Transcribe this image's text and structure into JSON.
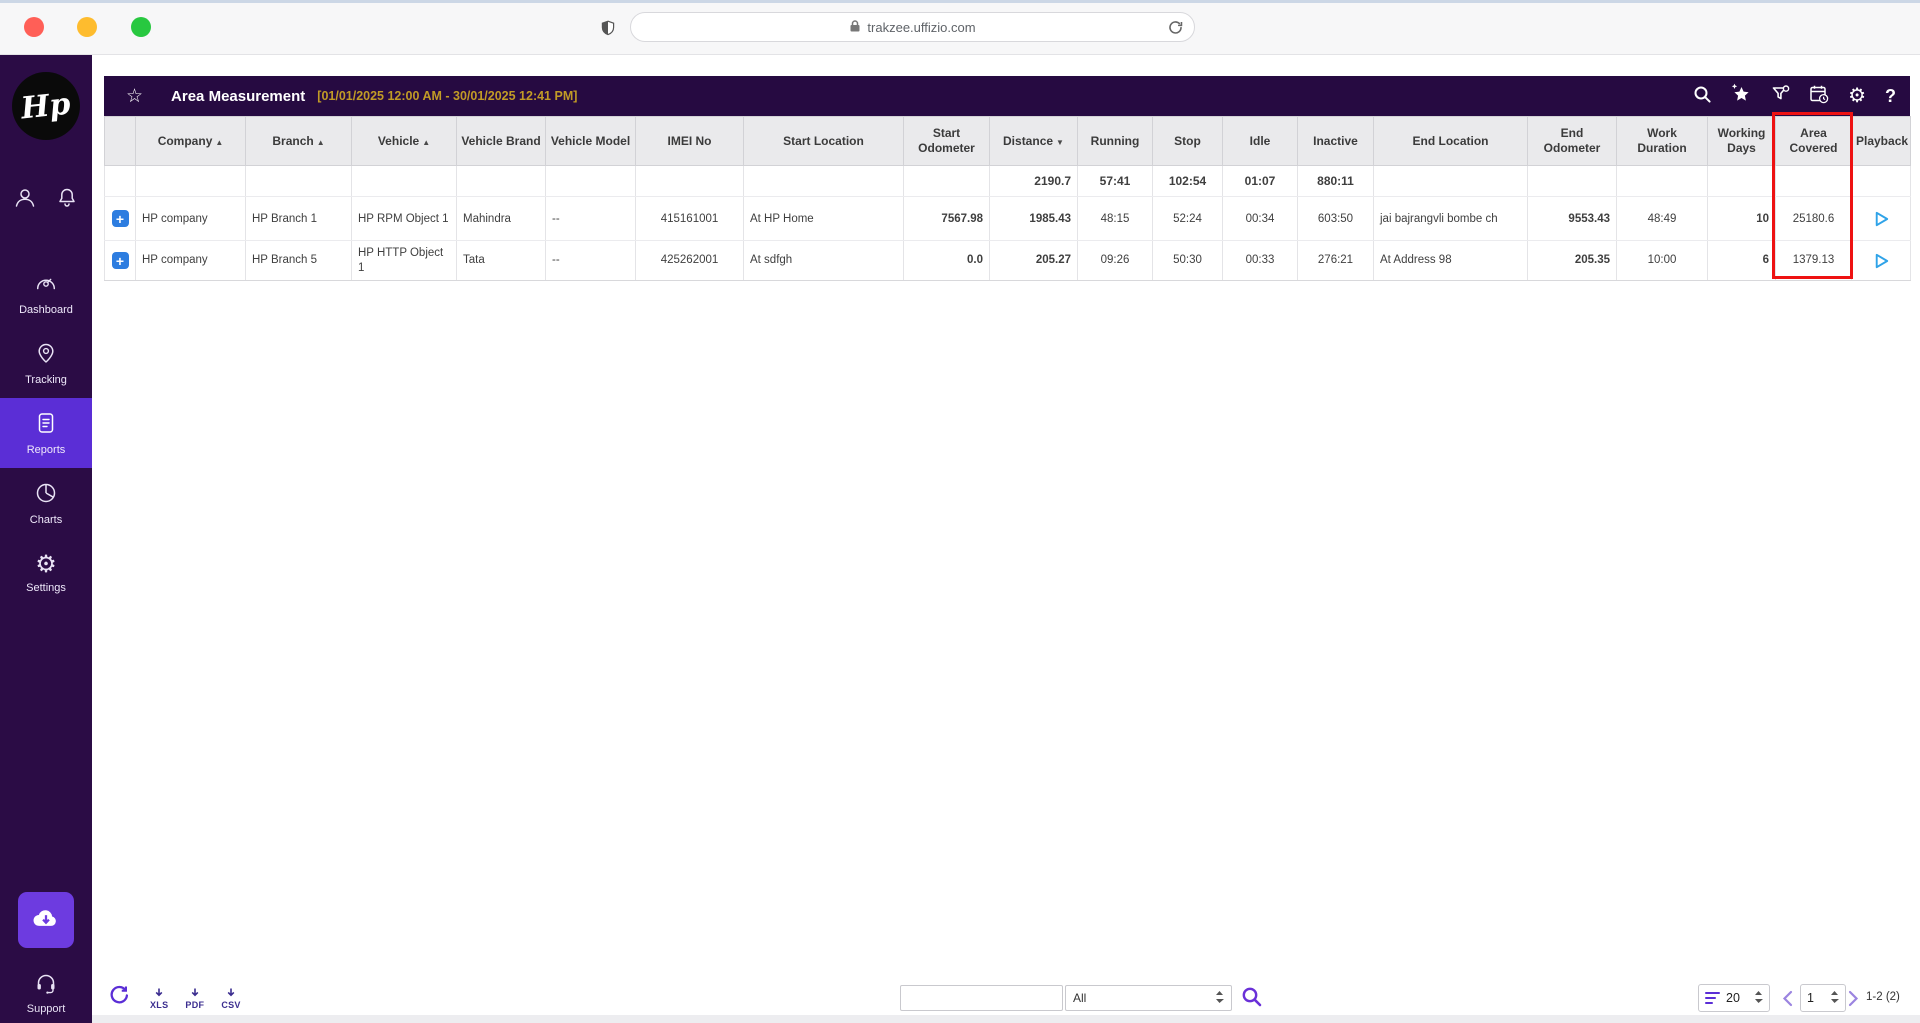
{
  "browser": {
    "url": "trakzee.uffizio.com"
  },
  "sidebar": {
    "logo": "Hp",
    "items": [
      {
        "label": "Dashboard",
        "icon": "dashboard-icon",
        "active": false
      },
      {
        "label": "Tracking",
        "icon": "tracking-icon",
        "active": false
      },
      {
        "label": "Reports",
        "icon": "reports-icon",
        "active": true
      },
      {
        "label": "Charts",
        "icon": "charts-icon",
        "active": false
      },
      {
        "label": "Settings",
        "icon": "settings-icon",
        "active": false
      }
    ],
    "support_label": "Support"
  },
  "header": {
    "title": "Area Measurement",
    "date_range": "[01/01/2025 12:00 AM - 30/01/2025 12:41 PM]",
    "icons": [
      "search-icon",
      "star-sparkle-icon",
      "filter-icon",
      "calendar-clock-icon",
      "gear-icon",
      "help-icon"
    ],
    "help_glyph": "?"
  },
  "table": {
    "expand_char": "+",
    "columns": [
      {
        "label": "",
        "sort": ""
      },
      {
        "label": "Company",
        "sort": "▲"
      },
      {
        "label": "Branch",
        "sort": "▲"
      },
      {
        "label": "Vehicle",
        "sort": "▲"
      },
      {
        "label": "Vehicle Brand",
        "sort": ""
      },
      {
        "label": "Vehicle Model",
        "sort": ""
      },
      {
        "label": "IMEI No",
        "sort": ""
      },
      {
        "label": "Start Location",
        "sort": ""
      },
      {
        "label": "Start Odometer",
        "sort": ""
      },
      {
        "label": "Distance",
        "sort": "▼"
      },
      {
        "label": "Running",
        "sort": ""
      },
      {
        "label": "Stop",
        "sort": ""
      },
      {
        "label": "Idle",
        "sort": ""
      },
      {
        "label": "Inactive",
        "sort": ""
      },
      {
        "label": "End Location",
        "sort": ""
      },
      {
        "label": "End Odometer",
        "sort": ""
      },
      {
        "label": "Work Duration",
        "sort": ""
      },
      {
        "label": "Working Days",
        "sort": ""
      },
      {
        "label": "Area Covered",
        "sort": ""
      },
      {
        "label": "Playback",
        "sort": ""
      }
    ],
    "summary": {
      "distance": "2190.7",
      "running": "57:41",
      "stop": "102:54",
      "idle": "01:07",
      "inactive": "880:11"
    },
    "rows": [
      {
        "company": "HP company",
        "branch": "HP Branch 1",
        "vehicle": "HP RPM Object 1",
        "vehicle_brand": "Mahindra",
        "vehicle_model": "--",
        "imei_no": "415161001",
        "start_location": "At HP Home",
        "start_odometer": "7567.98",
        "distance": "1985.43",
        "running": "48:15",
        "stop": "52:24",
        "idle": "00:34",
        "inactive": "603:50",
        "end_location": "jai bajrangvli bombe ch",
        "end_odometer": "9553.43",
        "work_duration": "48:49",
        "working_days": "10",
        "area_covered": "25180.6"
      },
      {
        "company": "HP company",
        "branch": "HP Branch 5",
        "vehicle": "HP HTTP Object 1",
        "vehicle_brand": "Tata",
        "vehicle_model": "--",
        "imei_no": "425262001",
        "start_location": "At sdfgh",
        "start_odometer": "0.0",
        "distance": "205.27",
        "running": "09:26",
        "stop": "50:30",
        "idle": "00:33",
        "inactive": "276:21",
        "end_location": "At Address 98",
        "end_odometer": "205.35",
        "work_duration": "10:00",
        "working_days": "6",
        "area_covered": "1379.13"
      }
    ]
  },
  "footer": {
    "export_labels": [
      "XLS",
      "PDF",
      "CSV"
    ],
    "search_value": "",
    "filter_selected": "All",
    "page_size": "20",
    "page": "1",
    "range_label": "1-2 (2)"
  },
  "colors": {
    "sidebar_bg": "#2b0c45",
    "active_item": "#5b2ed6",
    "header_bg": "#260a41",
    "date_range_text": "#c19b26",
    "running_green": "#2f9e44",
    "stop_red": "#e5393d",
    "idle_orange": "#f2a254",
    "inactive_blue": "#3f51b5",
    "highlight_red": "#ee1212",
    "accent_purple": "#5b2ed6",
    "play_blue": "#2fa3e8",
    "expand_blue": "#2d7de0"
  }
}
